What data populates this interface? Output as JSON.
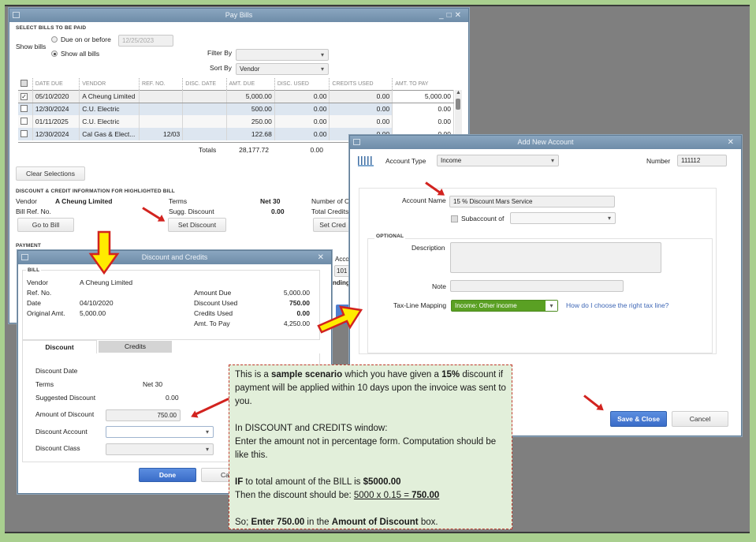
{
  "pay_bills": {
    "title": "Pay Bills",
    "section_select": "SELECT BILLS TO BE PAID",
    "show_bills_label": "Show bills",
    "due_on_or_before_label": "Due on or before",
    "due_date_value": "12/25/2023",
    "show_all_bills_label": "Show all bills",
    "filter_by_label": "Filter By",
    "filter_by_value": "",
    "sort_by_label": "Sort By",
    "sort_by_value": "Vendor",
    "columns": [
      "DATE DUE",
      "VENDOR",
      "REF. NO.",
      "DISC. DATE",
      "AMT. DUE",
      "DISC. USED",
      "CREDITS USED",
      "AMT. TO PAY"
    ],
    "rows": [
      {
        "checked": true,
        "date_due": "05/10/2020",
        "vendor": "A Cheung Limited",
        "ref_no": "",
        "disc_date": "",
        "amt_due": "5,000.00",
        "disc_used": "0.00",
        "credits_used": "0.00",
        "amt_to_pay": "5,000.00"
      },
      {
        "checked": false,
        "date_due": "12/30/2024",
        "vendor": "C.U. Electric",
        "ref_no": "",
        "disc_date": "",
        "amt_due": "500.00",
        "disc_used": "0.00",
        "credits_used": "0.00",
        "amt_to_pay": "0.00"
      },
      {
        "checked": false,
        "date_due": "01/11/2025",
        "vendor": "C.U. Electric",
        "ref_no": "",
        "disc_date": "",
        "amt_due": "250.00",
        "disc_used": "0.00",
        "credits_used": "0.00",
        "amt_to_pay": "0.00"
      },
      {
        "checked": false,
        "date_due": "12/30/2024",
        "vendor": "Cal Gas & Elect...",
        "ref_no": "12/03",
        "disc_date": "",
        "amt_due": "122.68",
        "disc_used": "0.00",
        "credits_used": "0.00",
        "amt_to_pay": "0.00"
      }
    ],
    "totals_label": "Totals",
    "total_amt_due": "28,177.72",
    "total_disc_used": "0.00",
    "clear_selections_label": "Clear Selections",
    "section_discount_credit": "DISCOUNT & CREDIT INFORMATION FOR HIGHLIGHTED BILL",
    "vendor_label": "Vendor",
    "vendor_value": "A Cheung Limited",
    "bill_ref_label": "Bill Ref. No.",
    "terms_label": "Terms",
    "terms_value": "Net 30",
    "sugg_discount_label": "Sugg. Discount",
    "sugg_discount_value": "0.00",
    "number_of_credits_label": "Number of C",
    "total_credits_label": "Total Credits",
    "go_to_bill_label": "Go to Bill",
    "set_discount_label": "Set Discount",
    "set_credits_label": "Set Cred",
    "section_payment": "PAYMENT",
    "account_label": "Acco",
    "account_value": "101",
    "ending_label": "nding"
  },
  "discount_credits": {
    "title": "Discount and Credits",
    "section_bill": "BILL",
    "vendor_label": "Vendor",
    "vendor_value": "A Cheung Limited",
    "ref_no_label": "Ref. No.",
    "date_label": "Date",
    "date_value": "04/10/2020",
    "original_amt_label": "Original Amt.",
    "original_amt_value": "5,000.00",
    "amount_due_label": "Amount Due",
    "amount_due_value": "5,000.00",
    "discount_used_label": "Discount Used",
    "discount_used_value": "750.00",
    "credits_used_label": "Credits Used",
    "credits_used_value": "0.00",
    "amt_to_pay_label": "Amt. To Pay",
    "amt_to_pay_value": "4,250.00",
    "tab_discount": "Discount",
    "tab_credits": "Credits",
    "discount_date_label": "Discount Date",
    "terms_label": "Terms",
    "terms_value": "Net 30",
    "suggested_discount_label": "Suggested Discount",
    "suggested_discount_value": "0.00",
    "amount_of_discount_label": "Amount of Discount",
    "amount_of_discount_value": "750.00",
    "discount_account_label": "Discount Account",
    "discount_account_value": "",
    "discount_class_label": "Discount Class",
    "discount_class_value": "",
    "done_label": "Done",
    "cancel_label": "Can"
  },
  "add_account": {
    "title": "Add New Account",
    "account_type_label": "Account Type",
    "account_type_value": "Income",
    "number_label": "Number",
    "number_value": "111112",
    "account_name_label": "Account Name",
    "account_name_value": "15 % Discount Mars Service",
    "subaccount_label": "Subaccount of",
    "subaccount_value": "",
    "section_optional": "OPTIONAL",
    "description_label": "Description",
    "description_value": "",
    "note_label": "Note",
    "note_value": "",
    "tax_line_label": "Tax-Line Mapping",
    "tax_line_value": "Income: Other income",
    "tax_line_help": "How do I choose the right tax line?",
    "save_close_label": "Save & Close",
    "cancel_label": "Cancel"
  },
  "note": {
    "p1_a": "This is a ",
    "p1_b": "sample scenario",
    "p1_c": " which you have given a ",
    "p1_d": "15%",
    "p1_e": " discount if payment will be applied within 10 days upon the invoice was sent to you.",
    "p2_a": "In DISCOUNT and CREDITS window:",
    "p2_b": "Enter the amount not in percentage form. Computation should be like this.",
    "p3_a": "IF",
    "p3_b": " to total amount of the BILL is ",
    "p3_c": "$5000.00",
    "p3_d": "Then the discount should be:  ",
    "p3_e": "5000 x 0.15 = ",
    "p3_f": "750.00",
    "p4_a": "So; ",
    "p4_b": "Enter 750.00",
    "p4_c": " in the ",
    "p4_d": "Amount of Discount",
    "p4_e": " box."
  }
}
